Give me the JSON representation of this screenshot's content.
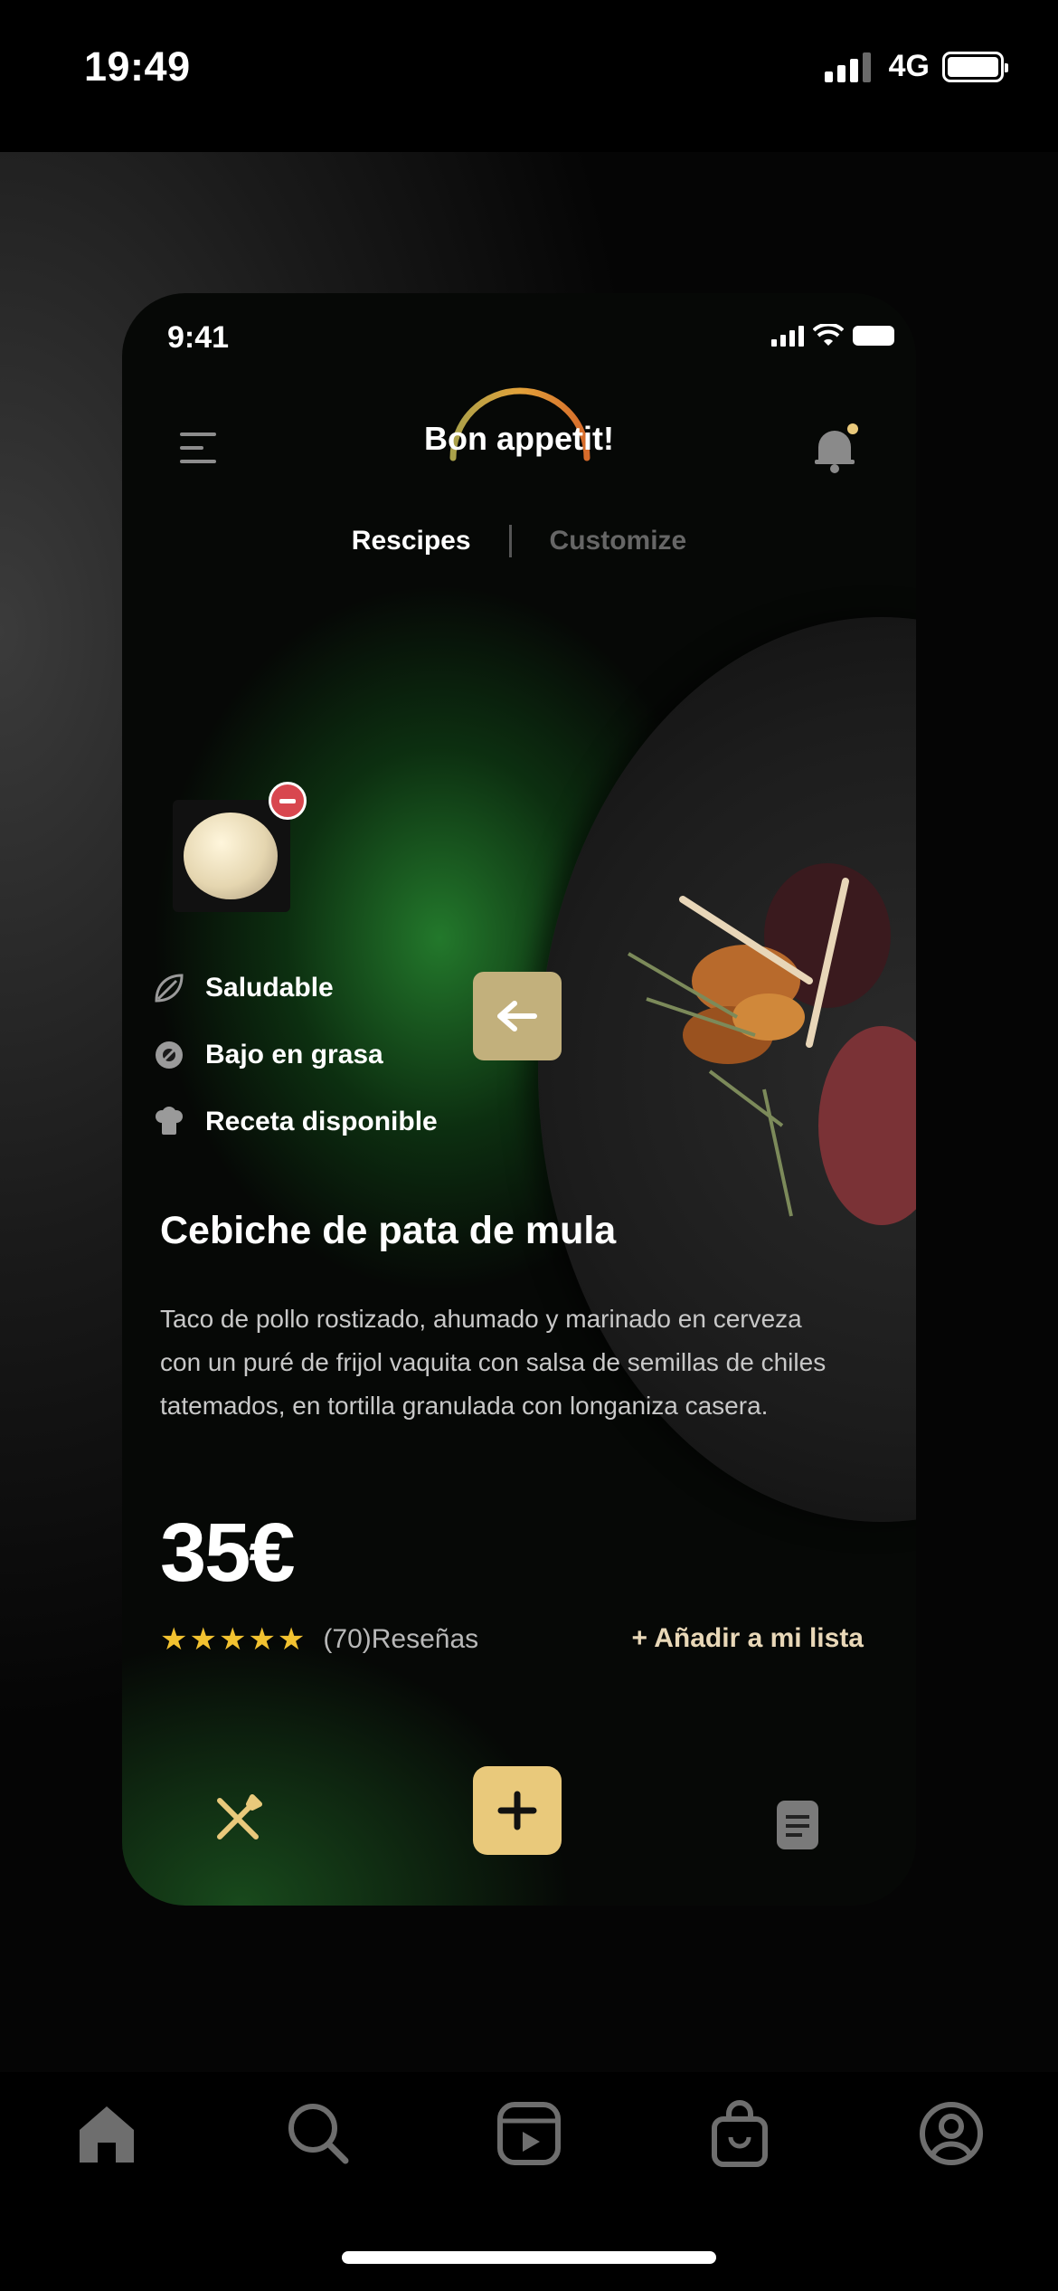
{
  "os_status": {
    "time": "19:49",
    "network": "4G"
  },
  "mockup": {
    "status_time": "9:41",
    "brand": "Bon appetit!",
    "tabs": [
      {
        "label": "Rescipes",
        "active": true
      },
      {
        "label": "Customize",
        "active": false
      }
    ],
    "features": [
      {
        "label": "Saludable",
        "icon": "leaf-icon"
      },
      {
        "label": "Bajo en grasa",
        "icon": "no-fat-icon"
      },
      {
        "label": "Receta disponible",
        "icon": "chef-hat-icon"
      }
    ],
    "dish_title": "Cebiche de pata de mula",
    "description": "Taco de pollo rostizado, ahumado y marinado en cerveza con un puré de frijol vaquita con salsa de semillas de chiles tatemados, en tortilla granulada con longaniza casera.",
    "price": "35€",
    "rating": {
      "stars": 5,
      "reviews": "(70)Reseñas"
    },
    "add_to_list": "+ Añadir a mi lista",
    "colors": {
      "accent": "#e9c97b",
      "star": "#f2c230",
      "minus_badge": "#d8474f"
    }
  },
  "bottom_tabs": [
    "home-icon",
    "search-icon",
    "reels-icon",
    "shop-icon",
    "profile-icon"
  ]
}
